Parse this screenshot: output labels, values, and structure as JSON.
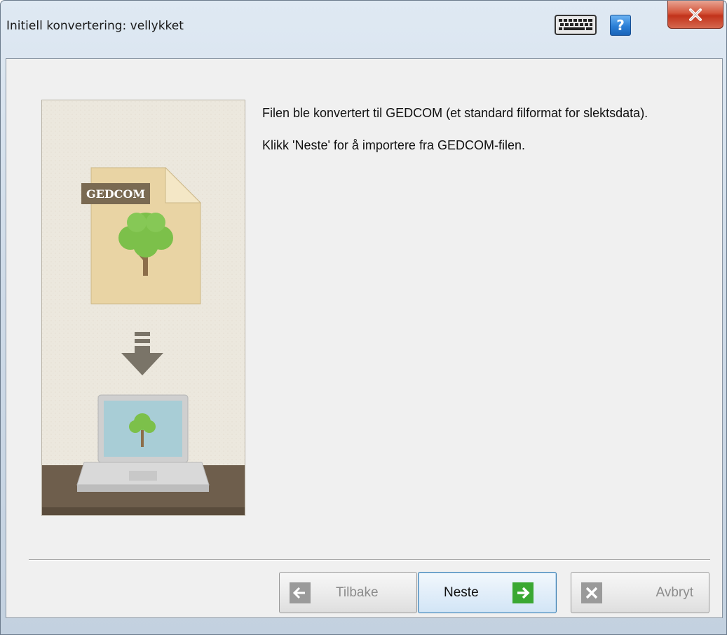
{
  "window": {
    "title": "Initiell konvertering: vellykket",
    "help_label": "?"
  },
  "illustration": {
    "file_label": "GEDCOM"
  },
  "message": {
    "line1": "Filen ble konvertert til GEDCOM (et standard filformat for slektsdata).",
    "line2": "Klikk 'Neste' for å importere fra GEDCOM-filen."
  },
  "buttons": {
    "back": {
      "label": "Tilbake",
      "icon": "arrow-left-icon",
      "enabled": false
    },
    "next": {
      "label": "Neste",
      "icon": "arrow-right-icon",
      "enabled": true
    },
    "cancel": {
      "label": "Avbryt",
      "icon": "close-x-icon",
      "enabled": false
    }
  },
  "colors": {
    "accent_green": "#3aa832",
    "tree_green": "#7cc04a",
    "close_red": "#c9452b"
  }
}
